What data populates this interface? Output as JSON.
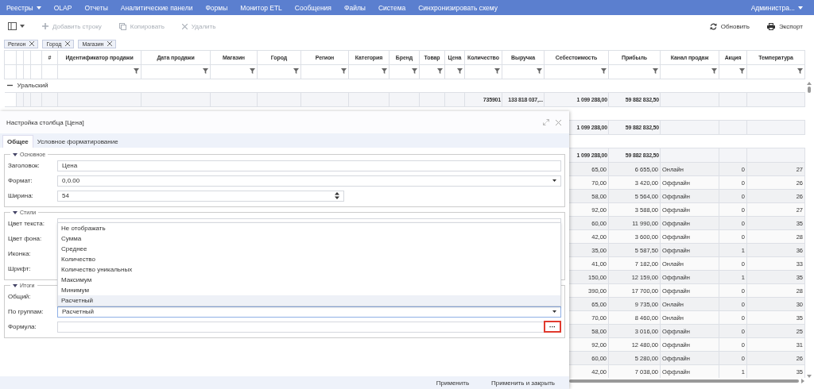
{
  "menu": [
    {
      "label": "Реестры",
      "dropdown": true
    },
    {
      "label": "OLAP",
      "dropdown": false
    },
    {
      "label": "Отчеты",
      "dropdown": false
    },
    {
      "label": "Аналитические панели",
      "dropdown": false
    },
    {
      "label": "Формы",
      "dropdown": false
    },
    {
      "label": "Монитор ETL",
      "dropdown": false
    },
    {
      "label": "Сообщения",
      "dropdown": false
    },
    {
      "label": "Файлы",
      "dropdown": false
    },
    {
      "label": "Система",
      "dropdown": false
    },
    {
      "label": "Синхронизировать схему",
      "dropdown": false
    }
  ],
  "user_menu": {
    "label": "Администра...",
    "dropdown": true
  },
  "toolbar": {
    "layout_button": {
      "dropdown": true
    },
    "left": [
      {
        "label": "Добавить строку",
        "disabled": true
      },
      {
        "label": "Копировать",
        "disabled": true
      },
      {
        "label": "Удалить",
        "disabled": true
      }
    ],
    "right": [
      {
        "label": "Обновить",
        "disabled": false
      },
      {
        "label": "Экспорт",
        "disabled": false
      }
    ]
  },
  "filter_chips": [
    "Регион",
    "Город",
    "Магазин"
  ],
  "table": {
    "number_header": "#",
    "columns": [
      "Идентификатор продажи",
      "Дата продажи",
      "Магазин",
      "Город",
      "Регион",
      "Категория",
      "Бренд",
      "Товар",
      "Цена",
      "Количество",
      "Выручка",
      "Себестоимость",
      "Прибыль",
      "Канал продаж",
      "Акция",
      "Температура"
    ],
    "body": [
      {
        "kind": "group",
        "label": "Уральский",
        "expanded": true
      },
      {
        "kind": "total",
        "cells": [
          null,
          null,
          null,
          null,
          null,
          null,
          null,
          null,
          null,
          "735901",
          "133 818 037,...",
          "1 099 288,00",
          "59 882 832,50",
          null,
          null,
          null
        ]
      },
      {
        "kind": "group"
      },
      {
        "kind": "total",
        "cells": [
          null,
          null,
          null,
          null,
          null,
          null,
          null,
          null,
          null,
          null,
          null,
          "1 099 288,00",
          "59 882 832,50",
          null,
          null,
          null
        ]
      },
      {
        "kind": "group"
      },
      {
        "kind": "total",
        "cells": [
          null,
          null,
          null,
          null,
          null,
          null,
          null,
          null,
          null,
          null,
          null,
          "1 099 288,00",
          "59 882 832,50",
          null,
          null,
          null
        ]
      },
      {
        "kind": "data",
        "cells": [
          null,
          null,
          null,
          null,
          null,
          null,
          null,
          null,
          null,
          null,
          null,
          "65,00",
          "6 655,00",
          "Онлайн",
          "0",
          "27"
        ]
      },
      {
        "kind": "data",
        "cells": [
          null,
          null,
          null,
          null,
          null,
          null,
          null,
          null,
          null,
          null,
          null,
          "70,00",
          "3 420,00",
          "Оффлайн",
          "0",
          "26"
        ]
      },
      {
        "kind": "data",
        "cells": [
          null,
          null,
          null,
          null,
          null,
          null,
          null,
          null,
          null,
          null,
          null,
          "58,00",
          "5 564,00",
          "Оффлайн",
          "0",
          "26"
        ]
      },
      {
        "kind": "data",
        "cells": [
          null,
          null,
          null,
          null,
          null,
          null,
          null,
          null,
          null,
          null,
          null,
          "92,00",
          "3 588,00",
          "Оффлайн",
          "0",
          "27"
        ]
      },
      {
        "kind": "data",
        "cells": [
          null,
          null,
          null,
          null,
          null,
          null,
          null,
          null,
          null,
          null,
          null,
          "60,00",
          "11 990,00",
          "Оффлайн",
          "0",
          "35"
        ]
      },
      {
        "kind": "data",
        "cells": [
          null,
          null,
          null,
          null,
          null,
          null,
          null,
          null,
          null,
          null,
          null,
          "42,00",
          "3 600,00",
          "Оффлайн",
          "0",
          "28"
        ]
      },
      {
        "kind": "data",
        "cells": [
          null,
          null,
          null,
          null,
          null,
          null,
          null,
          null,
          null,
          null,
          null,
          "35,00",
          "5 587,50",
          "Оффлайн",
          "1",
          "36"
        ]
      },
      {
        "kind": "data",
        "cells": [
          null,
          null,
          null,
          null,
          null,
          null,
          null,
          null,
          null,
          null,
          null,
          "41,00",
          "7 182,00",
          "Онлайн",
          "0",
          "33"
        ]
      },
      {
        "kind": "data",
        "cells": [
          null,
          null,
          null,
          null,
          null,
          null,
          null,
          null,
          null,
          null,
          null,
          "150,00",
          "12 159,00",
          "Оффлайн",
          "1",
          "35"
        ]
      },
      {
        "kind": "data",
        "cells": [
          null,
          null,
          null,
          null,
          null,
          null,
          null,
          null,
          null,
          null,
          null,
          "390,00",
          "17 700,00",
          "Оффлайн",
          "0",
          "28"
        ]
      },
      {
        "kind": "data",
        "cells": [
          null,
          null,
          null,
          null,
          null,
          null,
          null,
          null,
          null,
          null,
          null,
          "65,00",
          "9 735,00",
          "Онлайн",
          "0",
          "30"
        ]
      },
      {
        "kind": "data",
        "cells": [
          null,
          null,
          null,
          null,
          null,
          null,
          null,
          null,
          null,
          null,
          null,
          "70,00",
          "8 460,00",
          "Онлайн",
          "0",
          "35"
        ]
      },
      {
        "kind": "data",
        "cells": [
          null,
          null,
          null,
          null,
          null,
          null,
          null,
          null,
          null,
          null,
          null,
          "58,00",
          "3 016,00",
          "Оффлайн",
          "0",
          "25"
        ]
      },
      {
        "kind": "data",
        "cells": [
          null,
          null,
          null,
          null,
          null,
          null,
          null,
          null,
          null,
          null,
          null,
          "92,00",
          "12 480,00",
          "Оффлайн",
          "0",
          "31"
        ]
      },
      {
        "kind": "data",
        "cells": [
          null,
          null,
          null,
          null,
          null,
          null,
          null,
          null,
          null,
          null,
          null,
          "60,00",
          "5 280,00",
          "Оффлайн",
          "0",
          "26"
        ]
      },
      {
        "kind": "data",
        "cells": [
          null,
          null,
          null,
          null,
          null,
          null,
          null,
          null,
          null,
          null,
          null,
          "42,00",
          "7 038,00",
          "Оффлайн",
          "1",
          "35"
        ]
      }
    ]
  },
  "dialog": {
    "title": "Настройка столбца [Цена]",
    "tabs": [
      {
        "label": "Общее",
        "selected": true
      },
      {
        "label": "Условное форматирование",
        "selected": false
      }
    ],
    "sections": [
      {
        "title": "Основное",
        "expanded": true,
        "fields": [
          {
            "label": "Заголовок:",
            "kind": "text",
            "value": "Цена"
          },
          {
            "label": "Формат:",
            "kind": "select",
            "value": "0,0.00"
          },
          {
            "label": "Ширина:",
            "kind": "number",
            "value": "54"
          }
        ]
      },
      {
        "title": "Стили",
        "expanded": true,
        "fields": [
          {
            "label": "Цвет текста:",
            "kind": "select"
          },
          {
            "label": "Цвет фона:",
            "kind": "covered"
          },
          {
            "label": "Иконка:",
            "kind": "covered"
          },
          {
            "label": "Шрифт:",
            "kind": "covered"
          }
        ]
      },
      {
        "title": "Итоги",
        "expanded": true,
        "fields": [
          {
            "label": "Общий:",
            "kind": "covered"
          },
          {
            "label": "По группам:",
            "kind": "select",
            "value": "Расчетный",
            "focused": true,
            "open": true,
            "options": [
              {
                "label": "Не отображать",
                "selected": false
              },
              {
                "label": "Сумма",
                "selected": false
              },
              {
                "label": "Среднее",
                "selected": false
              },
              {
                "label": "Количество",
                "selected": false
              },
              {
                "label": "Количество уникальных",
                "selected": false
              },
              {
                "label": "Максимум",
                "selected": false
              },
              {
                "label": "Минимум",
                "selected": false
              },
              {
                "label": "Расчетный",
                "selected": true
              }
            ]
          },
          {
            "label": "Формула:",
            "kind": "formula",
            "button": "···",
            "highlighted": true
          }
        ]
      }
    ],
    "buttons": [
      "Применить",
      "Применить и закрыть"
    ]
  }
}
